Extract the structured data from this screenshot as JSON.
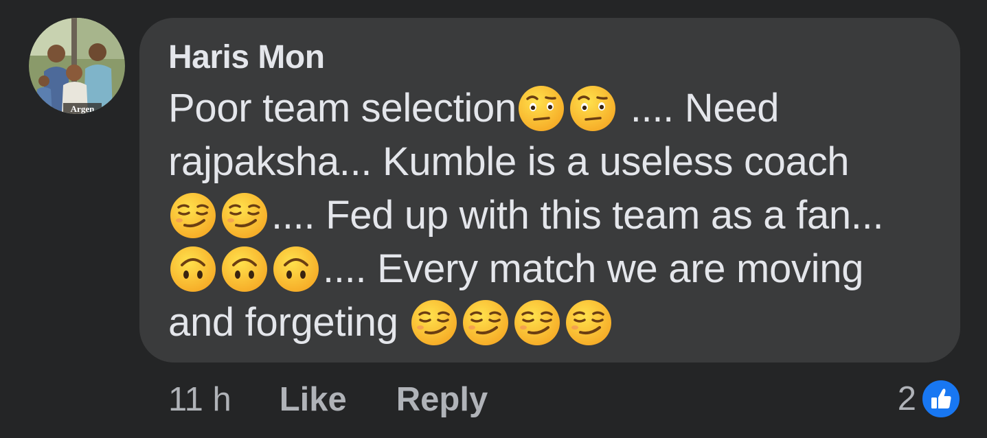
{
  "comment": {
    "author": "Haris Mon",
    "lines": [
      [
        {
          "type": "text",
          "value": "Poor team selection"
        },
        {
          "type": "emoji",
          "icon": "raised-eyebrow-emoji"
        },
        {
          "type": "emoji",
          "icon": "raised-eyebrow-emoji"
        },
        {
          "type": "text",
          "value": " .... Need"
        }
      ],
      [
        {
          "type": "text",
          "value": "rajpaksha... Kumble is a useless coach"
        }
      ],
      [
        {
          "type": "emoji",
          "icon": "smirking-emoji"
        },
        {
          "type": "emoji",
          "icon": "smirking-emoji"
        },
        {
          "type": "text",
          "value": ".... Fed up with this team as a fan..."
        }
      ],
      [
        {
          "type": "emoji",
          "icon": "upside-down-emoji"
        },
        {
          "type": "emoji",
          "icon": "upside-down-emoji"
        },
        {
          "type": "emoji",
          "icon": "upside-down-emoji"
        },
        {
          "type": "text",
          "value": ".... Every match we are moving"
        }
      ],
      [
        {
          "type": "text",
          "value": "and forgeting "
        },
        {
          "type": "emoji",
          "icon": "smirking-emoji"
        },
        {
          "type": "emoji",
          "icon": "smirking-emoji"
        },
        {
          "type": "emoji",
          "icon": "smirking-emoji"
        },
        {
          "type": "emoji",
          "icon": "smirking-emoji"
        }
      ]
    ],
    "avatar_overlay_text": "Argen",
    "timestamp": "11 h",
    "like_label": "Like",
    "reply_label": "Reply",
    "reaction_count": "2",
    "reaction_icon": "thumbs-up-icon",
    "colors": {
      "background": "#242526",
      "bubble": "#3a3b3c",
      "text": "#e4e6eb",
      "secondary_text": "#b0b3b8",
      "like_blue": "#1877f2"
    }
  }
}
